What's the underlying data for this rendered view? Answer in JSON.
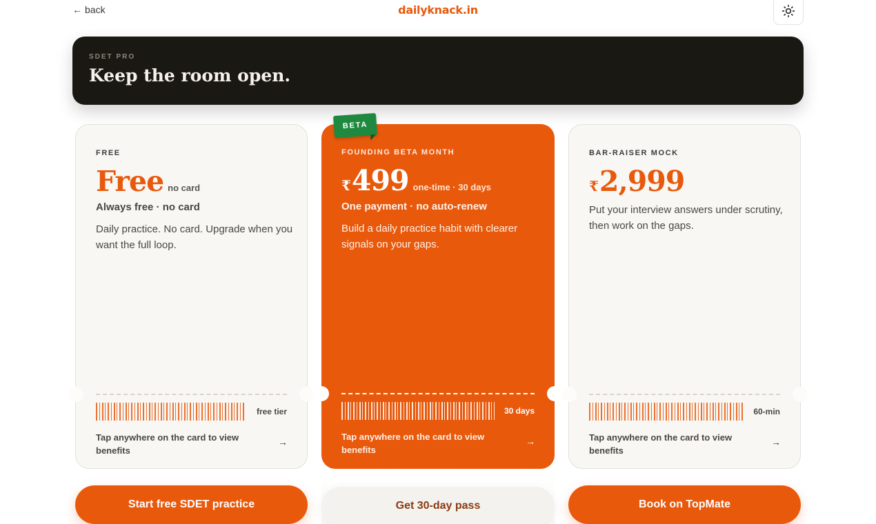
{
  "header": {
    "back_label": "back",
    "logo_text": "dailyknack.in"
  },
  "hero": {
    "eyebrow": "SDET PRO",
    "title": "Keep the room open."
  },
  "plans": [
    {
      "label": "FREE",
      "price": "Free",
      "price_note": "no card",
      "subhead": "Always free · no card",
      "description": "Daily practice. No card. Upgrade when you want the full loop.",
      "tag": "free tier",
      "tap_text": "Tap anywhere on the card to view benefits",
      "cta": "Start free SDET practice"
    },
    {
      "badge": "BETA",
      "label": "FOUNDING BETA MONTH",
      "currency": "₹",
      "price": "499",
      "price_note": "one-time · 30 days",
      "subhead": "One payment · no auto-renew",
      "description": "Build a daily practice habit with clearer signals on your gaps.",
      "tag": "30 days",
      "tap_text": "Tap anywhere on the card to view benefits",
      "cta": "Get 30-day pass"
    },
    {
      "label": "BAR-RAISER MOCK",
      "currency": "₹",
      "price": "2,999",
      "description": "Put your interview answers under scrutiny, then work on the gaps.",
      "tag": "60-min",
      "tap_text": "Tap anywhere on the card to view benefits",
      "cta": "Book on TopMate"
    }
  ],
  "colors": {
    "accent": "#e8590c",
    "hero_bg": "#1a1813",
    "card_bg": "#f8f7f4",
    "beta_badge": "#1f8a3f"
  },
  "icons": {
    "back": "arrow-left-icon",
    "theme": "sun-icon",
    "tap": "arrow-right-icon"
  }
}
